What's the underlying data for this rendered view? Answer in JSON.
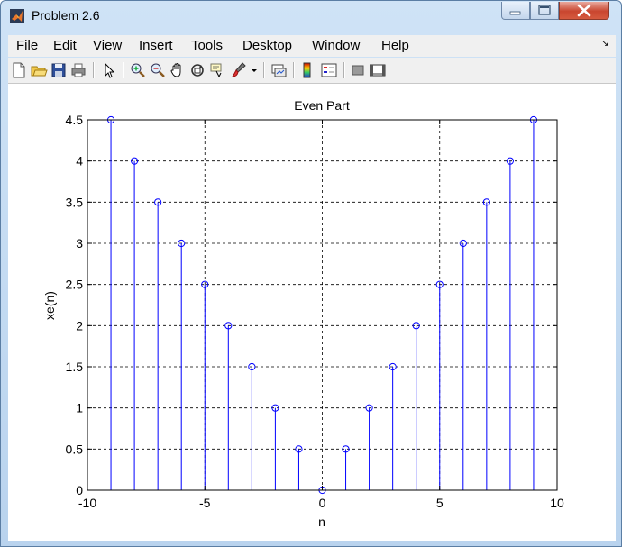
{
  "window": {
    "title": "Problem 2.6",
    "icon": "matlab-icon",
    "controls": [
      "minimize-icon",
      "maximize-icon",
      "close-icon"
    ]
  },
  "menu": {
    "items": [
      "File",
      "Edit",
      "View",
      "Insert",
      "Tools",
      "Desktop",
      "Window",
      "Help"
    ],
    "overflow_glyph": "↘"
  },
  "toolbar": {
    "icons": [
      "new-figure-icon",
      "open-file-icon",
      "save-icon",
      "print-icon",
      "select-arrow-icon",
      "zoom-in-icon",
      "zoom-out-icon",
      "pan-hand-icon",
      "rotate-3d-icon",
      "data-cursor-icon",
      "brush-icon",
      "dropdown-arrow-icon",
      "link-plot-icon",
      "colorbar-icon",
      "legend-icon",
      "hide-plot-tools-icon",
      "show-plot-tools-icon"
    ]
  },
  "chart_data": {
    "type": "stem",
    "title": "Even Part",
    "xlabel": "n",
    "ylabel": "xe(n)",
    "xlim": [
      -10,
      10
    ],
    "ylim": [
      0,
      4.5
    ],
    "xticks": [
      "-10",
      "-5",
      "0",
      "5",
      "10"
    ],
    "yticks": [
      "0",
      "0.5",
      "1",
      "1.5",
      "2",
      "2.5",
      "3",
      "3.5",
      "4",
      "4.5"
    ],
    "grid": true,
    "color": "#0000ff",
    "x": [
      -9,
      -8,
      -7,
      -6,
      -5,
      -4,
      -3,
      -2,
      -1,
      0,
      1,
      2,
      3,
      4,
      5,
      6,
      7,
      8,
      9
    ],
    "values": [
      4.5,
      4,
      3.5,
      3,
      2.5,
      2,
      1.5,
      1,
      0.5,
      0,
      0.5,
      1,
      1.5,
      2,
      2.5,
      3,
      3.5,
      4,
      4.5
    ]
  }
}
